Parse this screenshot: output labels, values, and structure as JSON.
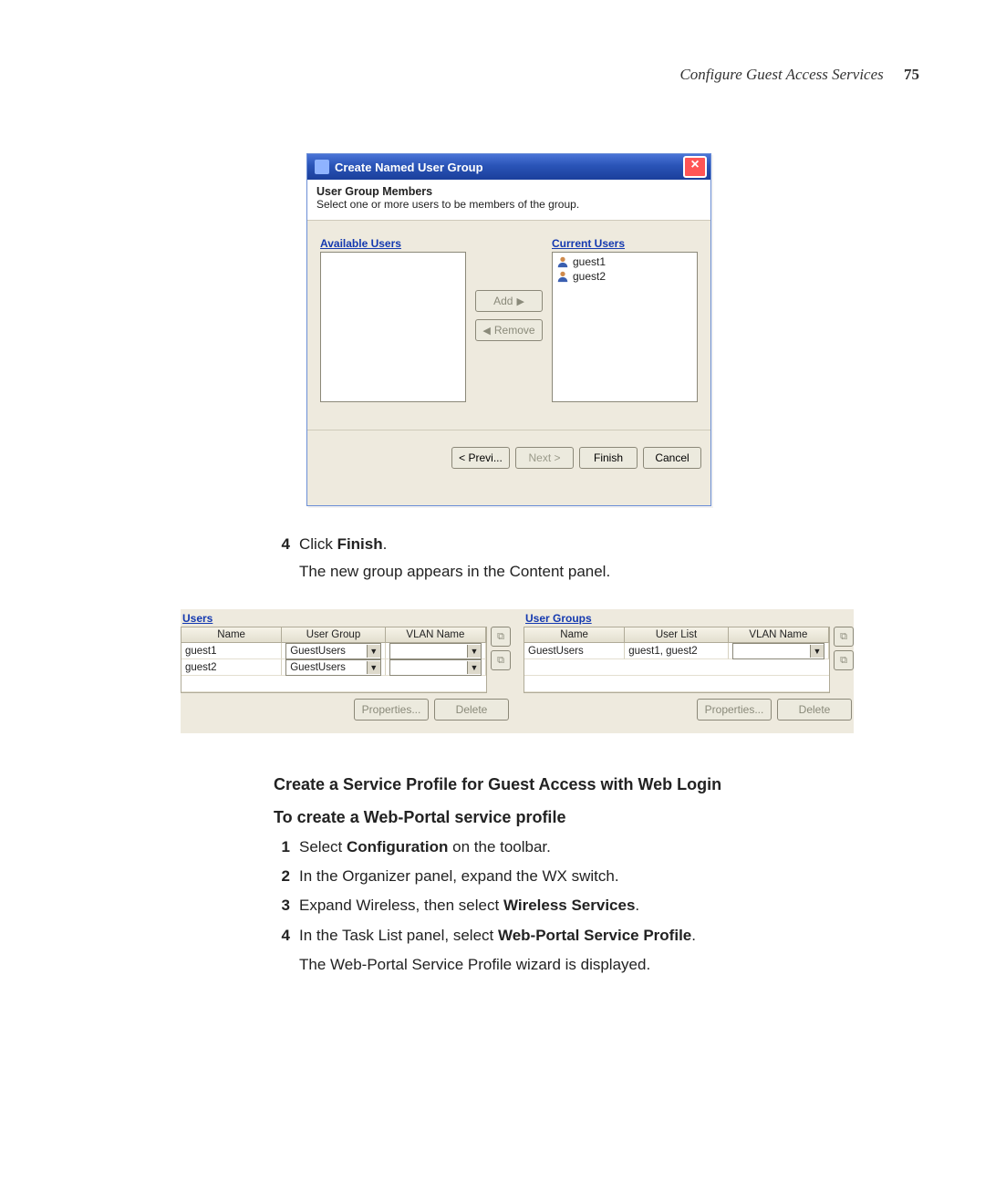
{
  "page": {
    "running_head": "Configure Guest Access Services",
    "page_number": "75"
  },
  "dialog": {
    "title": "Create Named User Group",
    "section_title": "User Group Members",
    "section_desc": "Select one or more users to be members of the group.",
    "available_label": "Available Users",
    "current_label": "Current Users",
    "current_users": [
      "guest1",
      "guest2"
    ],
    "add_label": "Add",
    "remove_label": "Remove",
    "prev_label": "< Previ...",
    "next_label": "Next >",
    "finish_label": "Finish",
    "cancel_label": "Cancel"
  },
  "text_a": {
    "step4_num": "4",
    "step4_a": "Click ",
    "step4_b": "Finish",
    "step4_c": ".",
    "line2": "The new group appears in the Content panel."
  },
  "panel": {
    "users": {
      "label": "Users",
      "headers": [
        "Name",
        "User Group",
        "VLAN Name"
      ],
      "rows": [
        {
          "name": "guest1",
          "group": "GuestUsers",
          "vlan": ""
        },
        {
          "name": "guest2",
          "group": "GuestUsers",
          "vlan": ""
        }
      ],
      "properties_label": "Properties...",
      "delete_label": "Delete"
    },
    "groups": {
      "label": "User Groups",
      "headers": [
        "Name",
        "User List",
        "VLAN Name"
      ],
      "rows": [
        {
          "name": "GuestUsers",
          "userlist": "guest1, guest2",
          "vlan": ""
        }
      ],
      "properties_label": "Properties...",
      "delete_label": "Delete"
    }
  },
  "text_b": {
    "heading1": "Create a Service Profile for Guest Access with Web Login",
    "heading2": "To create a Web-Portal service profile",
    "s1_n": "1",
    "s1_a": "Select ",
    "s1_b": "Configuration",
    "s1_c": " on the toolbar.",
    "s2_n": "2",
    "s2": "In the Organizer panel, expand the WX switch.",
    "s3_n": "3",
    "s3_a": "Expand Wireless, then select ",
    "s3_b": "Wireless Services",
    "s3_c": ".",
    "s4_n": "4",
    "s4_a": "In the Task List panel, select ",
    "s4_b": "Web-Portal Service Profile",
    "s4_c": ".",
    "s4_line2": "The Web-Portal Service Profile wizard is displayed."
  }
}
